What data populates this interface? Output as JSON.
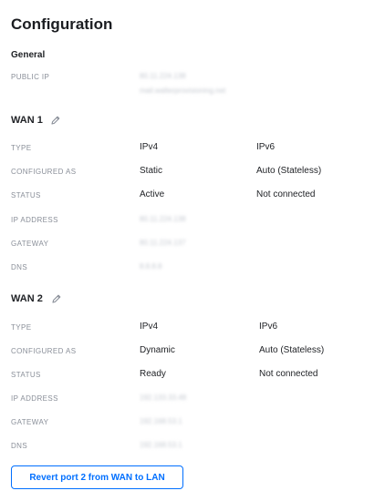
{
  "page": {
    "title": "Configuration",
    "general_heading": "General",
    "public_ip_label": "PUBLIC IP",
    "public_ip_value": "80.11.224.138",
    "public_ip_host": "mail.walterprovisioning.net"
  },
  "wan1": {
    "title": "WAN 1",
    "labels": {
      "type": "TYPE",
      "configured_as": "CONFIGURED AS",
      "status": "STATUS",
      "ip_address": "IP ADDRESS",
      "gateway": "GATEWAY",
      "dns": "DNS"
    },
    "ipv4": {
      "type": "IPv4",
      "configured_as": "Static",
      "status": "Active",
      "ip_address": "80.11.224.138",
      "gateway": "80.11.224.137",
      "dns": "8.8.8.8"
    },
    "ipv6": {
      "type": "IPv6",
      "configured_as": "Auto (Stateless)",
      "status": "Not connected"
    }
  },
  "wan2": {
    "title": "WAN 2",
    "labels": {
      "type": "TYPE",
      "configured_as": "CONFIGURED AS",
      "status": "STATUS",
      "ip_address": "IP ADDRESS",
      "gateway": "GATEWAY",
      "dns": "DNS"
    },
    "ipv4": {
      "type": "IPv4",
      "configured_as": "Dynamic",
      "status": "Ready",
      "ip_address": "192.133.33.48",
      "gateway": "192.168.53.1",
      "dns": "192.168.53.1"
    },
    "ipv6": {
      "type": "IPv6",
      "configured_as": "Auto (Stateless)",
      "status": "Not connected"
    }
  },
  "actions": {
    "revert_label": "Revert port 2 from WAN to LAN"
  },
  "colors": {
    "accent": "#006fff",
    "label": "#8a8f99",
    "text": "#212327",
    "redacted": "#c5c9d0"
  },
  "icons": {
    "edit": "pencil-icon"
  }
}
